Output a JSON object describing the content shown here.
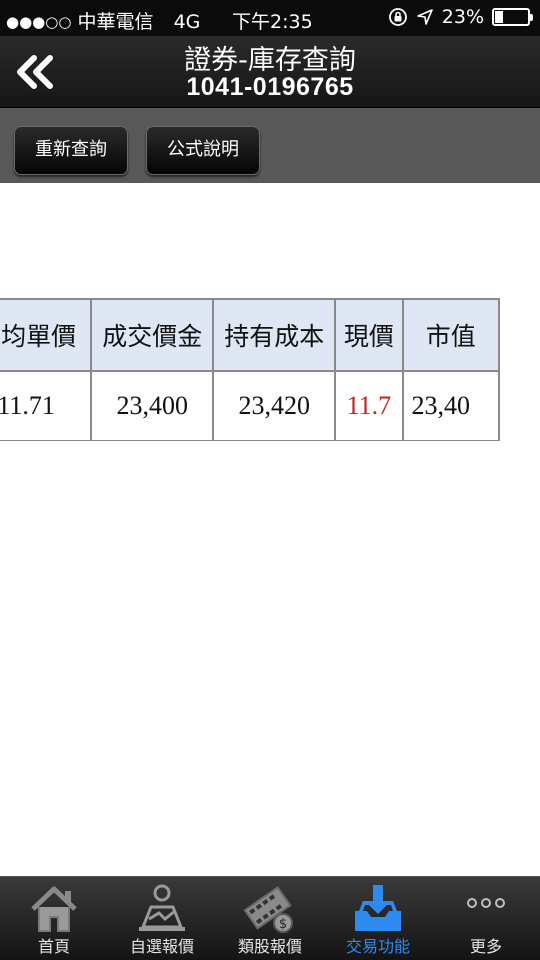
{
  "status_bar": {
    "signal_dots": "●●●○○",
    "carrier": "中華電信",
    "network": "4G",
    "time": "下午2:35",
    "battery": "23%",
    "battery_level": 0.23
  },
  "header": {
    "title": "證券-庫存查詢",
    "account": "1041-0196765"
  },
  "toolbar": {
    "requery_label": "重新查詢",
    "formula_label": "公式說明"
  },
  "table": {
    "headers": [
      "平均單價",
      "成交價金",
      "持有成本",
      "現價",
      "市值"
    ],
    "rows": [
      [
        "11.71",
        "23,400",
        "23,420",
        "11.7",
        "23,40"
      ]
    ],
    "price_color": "#cc1f1f"
  },
  "tab_bar": {
    "items": [
      {
        "label": "首頁",
        "icon": "home-icon"
      },
      {
        "label": "自選報價",
        "icon": "watchlist-icon"
      },
      {
        "label": "類股報價",
        "icon": "sector-quote-icon"
      },
      {
        "label": "交易功能",
        "icon": "trade-icon"
      },
      {
        "label": "更多",
        "icon": "more-icon"
      }
    ],
    "active_index": 3,
    "active_color": "#2d8bf0"
  }
}
